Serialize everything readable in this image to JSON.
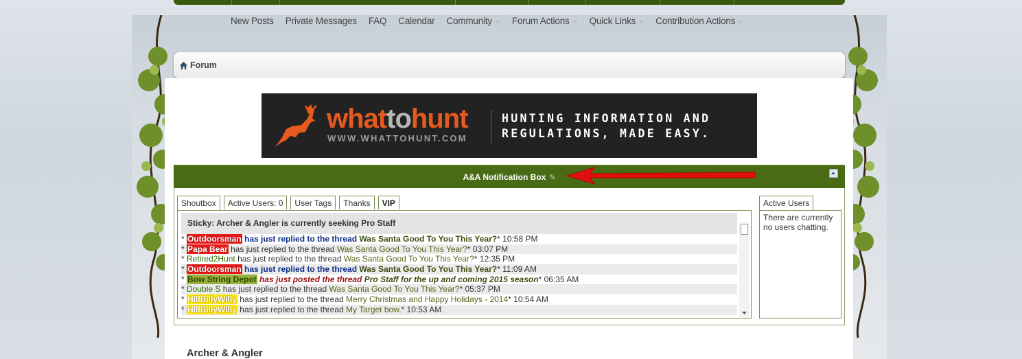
{
  "nav": {
    "items": [
      {
        "label": "New Posts",
        "dropdown": false
      },
      {
        "label": "Private Messages",
        "dropdown": false
      },
      {
        "label": "FAQ",
        "dropdown": false
      },
      {
        "label": "Calendar",
        "dropdown": false
      },
      {
        "label": "Community",
        "dropdown": true
      },
      {
        "label": "Forum Actions",
        "dropdown": true
      },
      {
        "label": "Quick Links",
        "dropdown": true
      },
      {
        "label": "Contribution Actions",
        "dropdown": true
      }
    ]
  },
  "breadcrumb": {
    "label": "Forum"
  },
  "banner": {
    "logo_what": "what",
    "logo_to": "to",
    "logo_hunt": "hunt",
    "url": "WWW.WHATTOHUNT.COM",
    "tagline_1": "HUNTING INFORMATION AND",
    "tagline_2": "REGULATIONS, MADE EASY."
  },
  "notification": {
    "title": "A&A Notification Box",
    "edit_icon": "pencil-icon",
    "collapse_icon": "collapse-icon"
  },
  "tabs": {
    "shoutbox": "Shoutbox",
    "active_users": "Active Users: 0",
    "user_tags": "User Tags",
    "thanks": "Thanks",
    "vip": "VIP"
  },
  "shoutbox": {
    "sticky": "Sticky: Archer & Angler is currently seeking Pro Staff",
    "rows": [
      {
        "user": "Outdoorsman",
        "action": "has just replied to the thread",
        "thread": "Was Santa Good To You This Year?",
        "time": "10:58 PM"
      },
      {
        "user": "Papa Bear",
        "action": "has just replied to the thread",
        "thread": "Was Santa Good To You This Year?",
        "time": "03:07 PM"
      },
      {
        "user": "Retired2Hunt",
        "action": "has just replied to the thread",
        "thread": "Was Santa Good To You This Year?",
        "time": "12:35 PM"
      },
      {
        "user": "Outdoorsman",
        "action": "has just replied to the thread",
        "thread": "Was Santa Good To You This Year?",
        "time": "11:09 AM"
      },
      {
        "user": "Bow String Depot",
        "action": "has just posted the thread",
        "thread": "Pro Staff for the up and coming 2015 season",
        "time": "06:35 AM"
      },
      {
        "user": "Double S",
        "action": "has just replied to the thread",
        "thread": "Was Santa Good To You This Year?",
        "time": "05:37 PM"
      },
      {
        "user": "HillBillyWilly",
        "action": "has just replied to the thread",
        "thread": "Merry Christmas and Happy Holidays - 2014",
        "time": "10:54 AM"
      },
      {
        "user": "HillBillyWilly",
        "action": "has just replied to the thread",
        "thread": "My Target bow.",
        "time": "10:53 AM"
      }
    ]
  },
  "active_users_panel": {
    "tab": "Active Users",
    "text": "There are currently no users chatting."
  },
  "footer": {
    "title": "Archer & Angler"
  },
  "colors": {
    "theme_green": "#4a6b16",
    "banner_orange": "#e65a1e",
    "arrow_red": "#e01010"
  }
}
